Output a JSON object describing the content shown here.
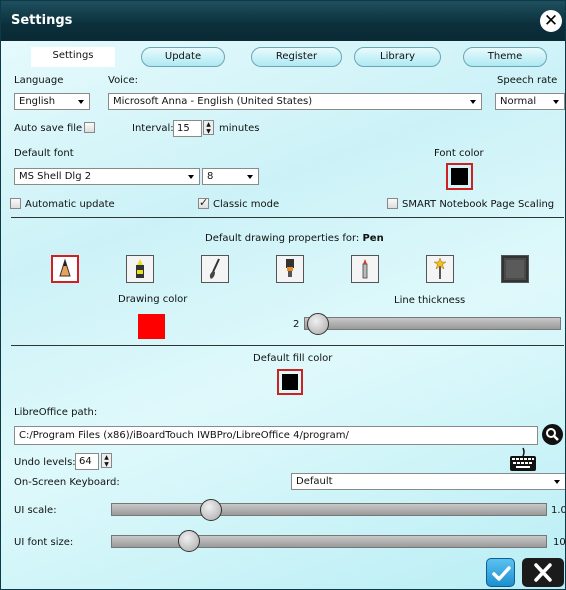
{
  "window": {
    "title": "Settings"
  },
  "tabs": [
    {
      "label": "Settings"
    },
    {
      "label": "Update"
    },
    {
      "label": "Register"
    },
    {
      "label": "Library"
    },
    {
      "label": "Theme"
    }
  ],
  "language": {
    "label": "Language",
    "value": "English"
  },
  "voice": {
    "label": "Voice:",
    "value": "Microsoft Anna - English (United States)"
  },
  "speech_rate": {
    "label": "Speech rate",
    "value": "Normal"
  },
  "autosave": {
    "label": "Auto save file",
    "checked": false
  },
  "interval": {
    "label": "Interval:",
    "value": "15",
    "unit": "minutes"
  },
  "default_font": {
    "label": "Default font",
    "family": "MS Shell Dlg 2",
    "size": "8"
  },
  "font_color": {
    "label": "Font color",
    "color": "#000000"
  },
  "checkboxes": {
    "automatic_update": {
      "label": "Automatic update",
      "checked": false
    },
    "classic_mode": {
      "label": "Classic mode",
      "checked": true
    },
    "smart_scaling": {
      "label": "SMART Notebook Page Scaling",
      "checked": false
    }
  },
  "drawing": {
    "header_prefix": "Default drawing properties for:",
    "header_tool": "Pen",
    "tools": [
      "pen-icon",
      "highlighter-icon",
      "brush-icon",
      "marker-icon",
      "pencil-icon",
      "magic-wand-icon",
      "texture-icon"
    ],
    "selected_tool": "pen-icon",
    "drawing_color_label": "Drawing color",
    "drawing_color": "#ff0000",
    "line_thickness_label": "Line thickness",
    "line_thickness": "2"
  },
  "fill": {
    "label": "Default fill color",
    "color": "#000000"
  },
  "libreoffice": {
    "label": "LibreOffice path:",
    "value": "C:/Program Files (x86)/iBoardTouch IWBPro/LibreOffice 4/program/"
  },
  "undo": {
    "label": "Undo levels:",
    "value": "64"
  },
  "keyboard": {
    "label": "On-Screen Keyboard:",
    "value": "Default"
  },
  "ui_scale": {
    "label": "UI scale:",
    "value": "1.0",
    "fraction": 0.23
  },
  "ui_font_size": {
    "label": "UI font size:",
    "value": "10",
    "fraction": 0.18
  },
  "colors": {
    "accent_red": "#d02020",
    "title_bar": "#0b2f3b"
  }
}
